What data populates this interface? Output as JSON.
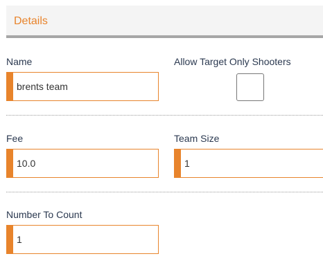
{
  "header": {
    "title": "Details"
  },
  "fields": {
    "name": {
      "label": "Name",
      "value": "brents team"
    },
    "allow_target_only": {
      "label": "Allow Target Only Shooters",
      "checked": false
    },
    "fee": {
      "label": "Fee",
      "value": "10.0"
    },
    "team_size": {
      "label": "Team Size",
      "value": "1"
    },
    "number_to_count": {
      "label": "Number To Count",
      "value": "1"
    }
  },
  "colors": {
    "accent": "#e8842c",
    "header_bg": "#f4f4f4",
    "header_border": "#a6a6a6",
    "label": "#2b3950"
  }
}
